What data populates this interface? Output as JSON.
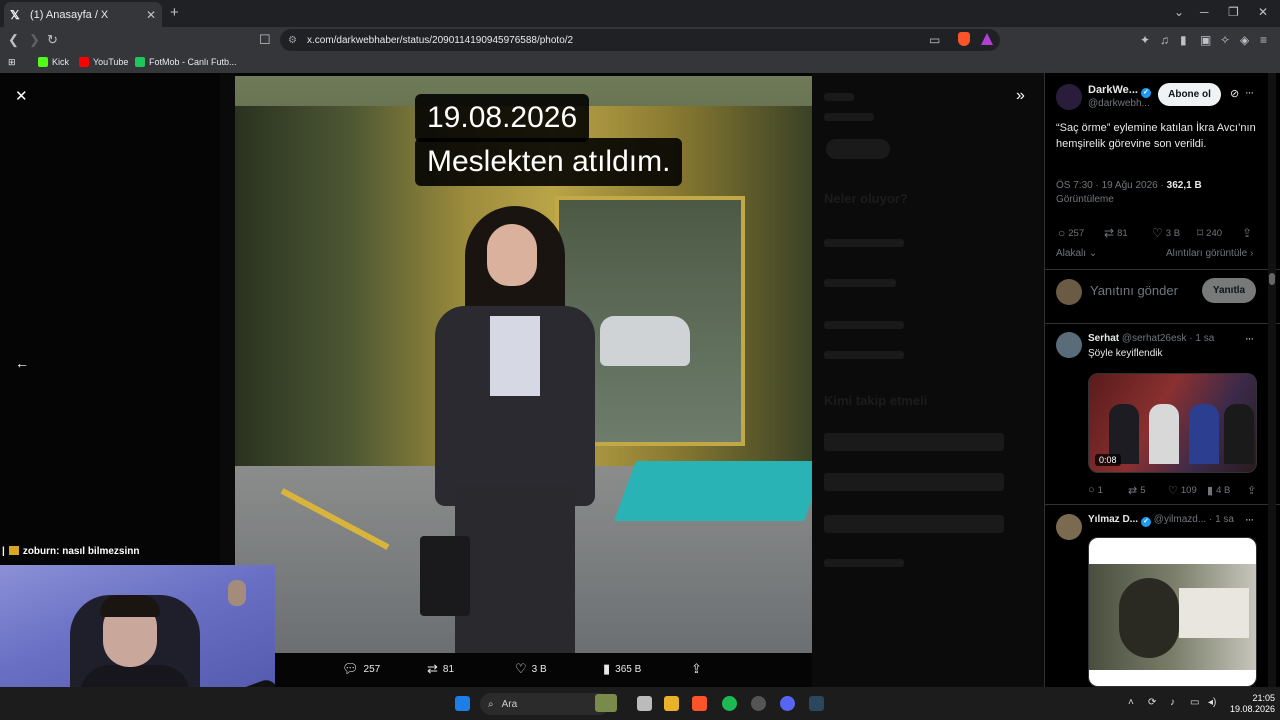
{
  "browser": {
    "tab_title": "(1) Anasayfa / X",
    "url": "x.com/darkwebhaber/status/2090114190945976588/photo/2",
    "bookmarks": [
      {
        "label": "Kick",
        "color": "#53fc18"
      },
      {
        "label": "YouTube",
        "color": "#ff0000"
      },
      {
        "label": "FotMob - Canlı Futb...",
        "color": "#1ec75b"
      }
    ]
  },
  "photo": {
    "caption_line1": "19.08.2026",
    "caption_line2": "Meslekten atıldım."
  },
  "photo_actions": {
    "replies": "257",
    "reposts": "81",
    "likes": "3 B",
    "views": "365 B"
  },
  "post": {
    "author": "DarkWe...",
    "handle": "@darkwebh...",
    "follow_label": "Abone ol",
    "text": "“Saç örme” eylemine katılan İkra Avcı’nın hemşirelik görevine son verildi.",
    "time": "ÖS 7:30 · 19 Ağu 2026 · ",
    "views_count": "362,1 B",
    "views_label": "Görüntüleme",
    "stats": {
      "replies": "257",
      "reposts": "81",
      "likes": "3 B",
      "bookmarks": "240"
    },
    "relevance_label": "Alakalı",
    "quotes_label": "Alıntıları görüntüle"
  },
  "reply_box": {
    "placeholder": "Yanıtını gönder",
    "button": "Yanıtla"
  },
  "replies": [
    {
      "name": "Serhat",
      "handle": "@serhat26esk · 1 sa",
      "text": "Şöyle keyiflendik",
      "video_duration": "0:08",
      "stats": {
        "replies": "1",
        "reposts": "5",
        "likes": "109",
        "views": "4 B"
      }
    },
    {
      "name": "Yılmaz D...",
      "handle": "@yilmazd... · 1 sa"
    }
  ],
  "background_sidebar": {
    "trends_title": "Neler oluyor?",
    "who_to_follow_title": "Kimi takip etmeli"
  },
  "stream_chat": {
    "user": "zoburn",
    "message": ": nasıl bilmezsinn"
  },
  "taskbar": {
    "search_label": "Ara",
    "time": "21:05",
    "date": "19.08.2026"
  },
  "colors": {
    "verified": "#1d9bf0",
    "x_bg": "#000000",
    "muted_text": "#71767b"
  }
}
